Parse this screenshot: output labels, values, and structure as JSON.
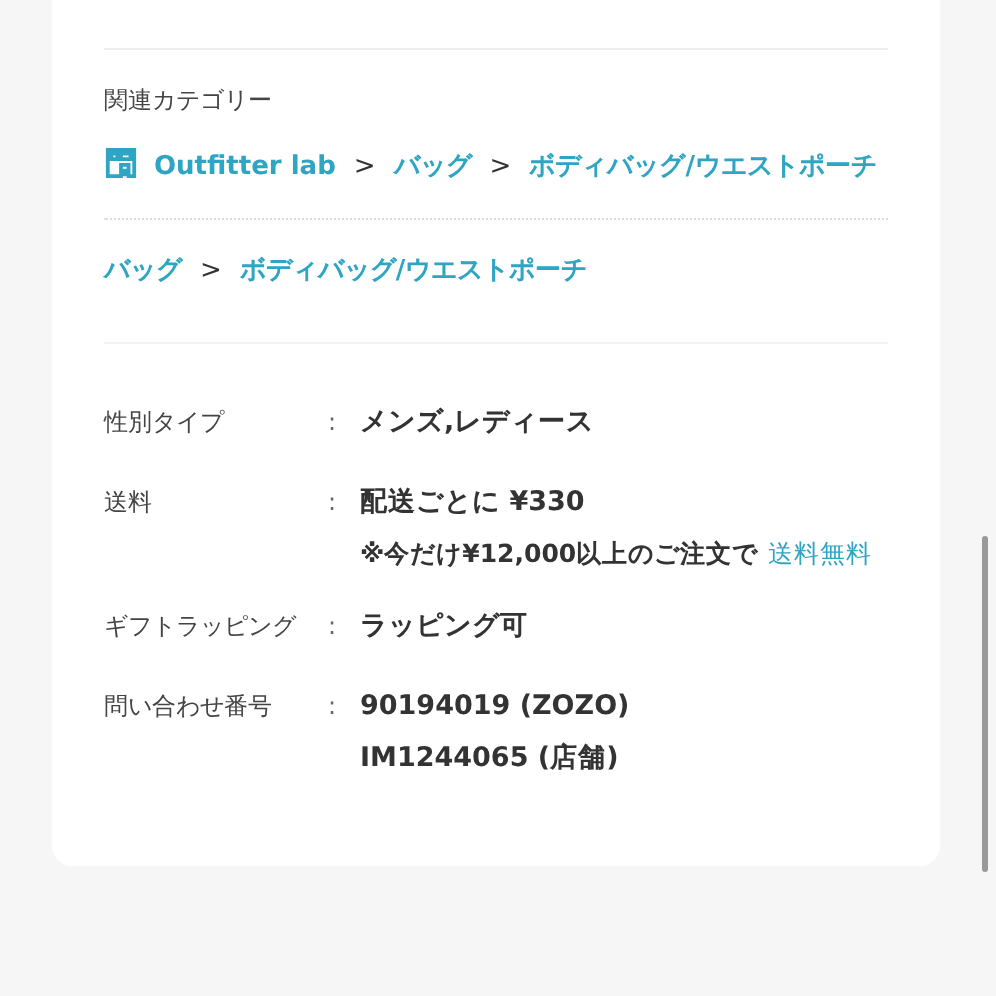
{
  "related_categories": {
    "heading": "関連カテゴリー",
    "paths": [
      {
        "items": [
          {
            "kind": "store",
            "text": "Outfitter lab"
          },
          {
            "kind": "separator",
            "text": ">"
          },
          {
            "kind": "link",
            "text": "バッグ"
          },
          {
            "kind": "separator",
            "text": ">"
          },
          {
            "kind": "link",
            "text": "ボディバッグ/ウエストポーチ"
          }
        ]
      },
      {
        "items": [
          {
            "kind": "link",
            "text": "バッグ"
          },
          {
            "kind": "separator",
            "text": ">"
          },
          {
            "kind": "link",
            "text": "ボディバッグ/ウエストポーチ"
          }
        ]
      }
    ]
  },
  "details": [
    {
      "label": "性別タイプ",
      "colon": ":",
      "values": [
        {
          "kind": "plain",
          "text": "メンズ,レディース"
        }
      ]
    },
    {
      "label": "送料",
      "colon": ":",
      "values": [
        {
          "kind": "plain",
          "text": "配送ごとに ¥330"
        },
        {
          "kind": "note",
          "text": "※今だけ¥12,000以上のご注文で",
          "link": "送料無料"
        }
      ]
    },
    {
      "label": "ギフトラッピング",
      "colon": ":",
      "values": [
        {
          "kind": "plain",
          "text": "ラッピング可"
        }
      ]
    },
    {
      "label": "問い合わせ番号",
      "colon": ":",
      "values": [
        {
          "kind": "plain",
          "text": "90194019 (ZOZO)"
        },
        {
          "kind": "plain",
          "text": "IM1244065 (店舗)"
        }
      ]
    }
  ]
}
